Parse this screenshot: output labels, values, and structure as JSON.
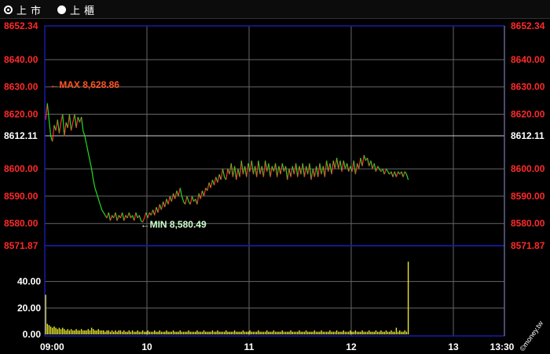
{
  "tabs": [
    {
      "label": "上市",
      "selected": true
    },
    {
      "label": "上櫃",
      "selected": false
    }
  ],
  "watermark": "©money.tw",
  "colors": {
    "background": "#000000",
    "grid": "#666666",
    "frame": "#1a1aa8",
    "price_line": "#22dd22",
    "price_label": "#ff2a2a",
    "volume_bar": "#e8e830",
    "max_annotation": "#ff5522",
    "min_annotation": "#ccffcc"
  },
  "chart_data": {
    "type": "line",
    "price": {
      "ylim": [
        8571.87,
        8652.34
      ],
      "reference": 8612.11,
      "tick_labels": [
        "8652.34",
        "8640.00",
        "8630.00",
        "8620.00",
        "8612.11",
        "8600.00",
        "8590.00",
        "8580.00",
        "8571.87"
      ],
      "tick_values": [
        8652.34,
        8640,
        8630,
        8620,
        8612.11,
        8600,
        8590,
        8580,
        8571.87
      ],
      "max": {
        "value": 8628.86,
        "label": "MAX 8,628.86",
        "time_index": 1
      },
      "min": {
        "value": 8580.49,
        "label": "MIN 8,580.49",
        "time_index": 57
      },
      "series": [
        {
          "values": [
            8618,
            8624,
            8618,
            8612,
            8610,
            8616,
            8614,
            8618,
            8613,
            8617,
            8620,
            8612,
            8617,
            8615,
            8620,
            8614,
            8617,
            8620,
            8615,
            8619,
            8617,
            8619,
            8614,
            8612,
            8609,
            8606,
            8603,
            8600,
            8596,
            8593,
            8591,
            8589,
            8587,
            8585,
            8584,
            8583,
            8582,
            8584,
            8581,
            8583,
            8582,
            8584,
            8581,
            8583,
            8582,
            8584,
            8581,
            8583,
            8582,
            8584,
            8582,
            8583,
            8581,
            8584,
            8582,
            8583,
            8581,
            8580.49,
            8582,
            8584,
            8582,
            8584,
            8583,
            8585,
            8583,
            8586,
            8584,
            8587,
            8585,
            8588,
            8586,
            8589,
            8587,
            8590,
            8588,
            8591,
            8589,
            8592,
            8590,
            8593,
            8590,
            8588,
            8587,
            8590,
            8588,
            8587,
            8590,
            8588,
            8589,
            8587,
            8591,
            8589,
            8592,
            8590,
            8593,
            8592,
            8595,
            8593,
            8596,
            8594,
            8597,
            8595,
            8598,
            8596,
            8600,
            8597,
            8596,
            8600,
            8598,
            8602,
            8597,
            8601,
            8596,
            8600,
            8597,
            8603,
            8598,
            8601,
            8597,
            8602,
            8599,
            8603,
            8598,
            8601,
            8597,
            8603,
            8598,
            8601,
            8597,
            8603,
            8599,
            8602,
            8597,
            8601,
            8599,
            8602,
            8597,
            8601,
            8598,
            8602,
            8599,
            8601,
            8596,
            8600,
            8597,
            8601,
            8598,
            8602,
            8597,
            8601,
            8598,
            8602,
            8597,
            8601,
            8598,
            8602,
            8596,
            8600,
            8597,
            8601,
            8597,
            8602,
            8598,
            8601,
            8597,
            8603,
            8599,
            8602,
            8598,
            8603,
            8600,
            8604,
            8600,
            8603,
            8599,
            8603,
            8600,
            8602,
            8599,
            8601,
            8599,
            8603,
            8598,
            8602,
            8600,
            8604,
            8601,
            8605,
            8603,
            8604,
            8601,
            8603,
            8600,
            8602,
            8599,
            8601,
            8600,
            8599,
            8600,
            8598,
            8600,
            8599,
            8598,
            8599,
            8597,
            8599,
            8597,
            8599,
            8598,
            8599,
            8597,
            8599,
            8598,
            8596
          ]
        }
      ]
    },
    "volume": {
      "ylim": [
        0,
        60
      ],
      "tick_labels": [
        "40.00",
        "20.00",
        "0.00"
      ],
      "tick_values": [
        40,
        20,
        0
      ],
      "values": [
        30,
        8,
        7,
        6,
        5,
        6,
        5,
        4,
        5,
        4,
        5,
        4,
        3,
        4,
        3,
        4,
        3,
        3,
        4,
        3,
        3,
        4,
        3,
        3,
        3,
        4,
        3,
        5,
        4,
        3,
        3,
        4,
        3,
        3,
        3,
        2,
        3,
        3,
        2,
        3,
        2,
        3,
        2,
        3,
        3,
        2,
        3,
        2,
        2,
        3,
        2,
        3,
        2,
        2,
        3,
        2,
        2,
        3,
        2,
        2,
        3,
        2,
        2,
        2,
        3,
        2,
        2,
        3,
        2,
        2,
        2,
        3,
        2,
        2,
        2,
        3,
        2,
        2,
        2,
        3,
        2,
        2,
        2,
        2,
        3,
        2,
        2,
        2,
        2,
        3,
        2,
        2,
        2,
        3,
        2,
        2,
        2,
        2,
        3,
        2,
        2,
        3,
        2,
        2,
        2,
        2,
        3,
        2,
        2,
        2,
        2,
        3,
        2,
        2,
        2,
        2,
        3,
        2,
        2,
        2,
        3,
        2,
        2,
        2,
        2,
        3,
        2,
        2,
        2,
        2,
        3,
        2,
        2,
        2,
        3,
        2,
        2,
        2,
        2,
        3,
        2,
        2,
        2,
        2,
        3,
        2,
        2,
        2,
        2,
        3,
        2,
        2,
        2,
        3,
        2,
        2,
        2,
        2,
        3,
        2,
        2,
        2,
        3,
        2,
        2,
        2,
        2,
        3,
        2,
        2,
        2,
        3,
        2,
        2,
        2,
        3,
        2,
        2,
        2,
        3,
        2,
        2,
        3,
        2,
        2,
        2,
        3,
        2,
        2,
        2,
        3,
        2,
        2,
        2,
        3,
        2,
        2,
        3,
        2,
        2,
        3,
        2,
        2,
        3,
        2,
        2,
        5,
        2,
        3,
        2,
        2,
        3,
        2,
        55
      ]
    },
    "x_tick_labels": [
      "09:00",
      "10",
      "11",
      "12",
      "13",
      "13:30"
    ],
    "x_tick_positions": [
      0,
      60,
      120,
      180,
      240,
      270
    ],
    "x_total": 270,
    "grid": true
  }
}
